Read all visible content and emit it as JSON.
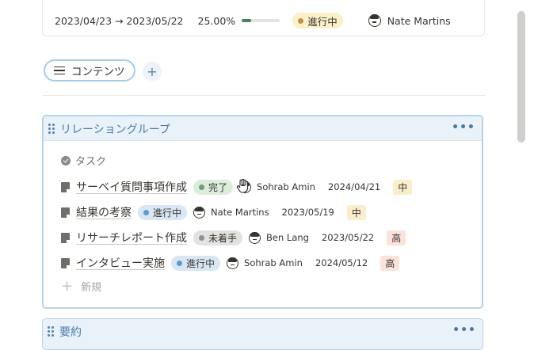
{
  "top_row": {
    "date_range": "2023/04/23 → 2023/05/22",
    "progress_text": "25.00%",
    "progress_fraction": 0.25,
    "status": "進行中",
    "assignee": "Nate Martins"
  },
  "tabs": {
    "active_label": "コンテンツ",
    "add_label": "+"
  },
  "group": {
    "title": "リレーショングループ",
    "more_label": "•••",
    "section_label": "タスク",
    "tasks": [
      {
        "name": "サーベイ質問事項作成",
        "status": "完了",
        "status_color": "green",
        "assignee": "Sohrab Amin",
        "date": "2024/04/21",
        "priority": "中",
        "priority_color": "mid"
      },
      {
        "name": "結果の考察",
        "status": "進行中",
        "status_color": "blue",
        "assignee": "Nate Martins",
        "date": "2023/05/19",
        "priority": "中",
        "priority_color": "mid"
      },
      {
        "name": "リサーチレポート作成",
        "status": "未着手",
        "status_color": "gray",
        "assignee": "Ben Lang",
        "date": "2023/05/22",
        "priority": "高",
        "priority_color": "high"
      },
      {
        "name": "インタビュー実施",
        "status": "進行中",
        "status_color": "blue",
        "assignee": "Sohrab Amin",
        "date": "2024/05/12",
        "priority": "高",
        "priority_color": "high"
      }
    ],
    "new_label": "新規"
  },
  "group2": {
    "title": "要約",
    "more_label": "•••"
  }
}
